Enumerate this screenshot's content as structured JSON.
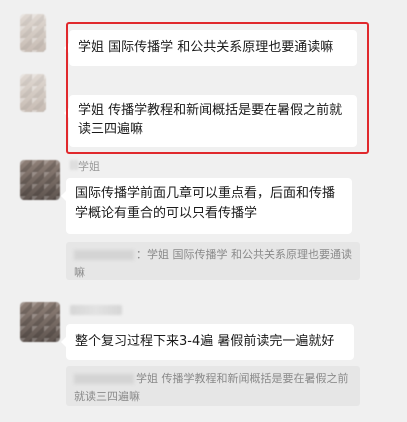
{
  "messages": [
    {
      "text": "学姐 国际传播学 和公共关系原理也要通读嘛"
    },
    {
      "text": "学姐 传播学教程和新闻概括是要在暑假之前就读三四遍嘛"
    },
    {
      "sender": "学姐",
      "text": "国际传播学前面几章可以重点看，后面和传播学概论有重合的可以只看传播学",
      "quote": "：学姐 国际传播学 和公共关系原理也要通读嘛"
    },
    {
      "text": "整个复习过程下来3-4遍 暑假前读完一遍就好",
      "quote": "学姐 传播学教程和新闻概括是要在暑假之前就读三四遍嘛"
    }
  ],
  "colors": {
    "background": "#f0f0f0",
    "bubble": "#ffffff",
    "quote_bg": "#e6e6e6",
    "highlight": "#e0282c"
  }
}
